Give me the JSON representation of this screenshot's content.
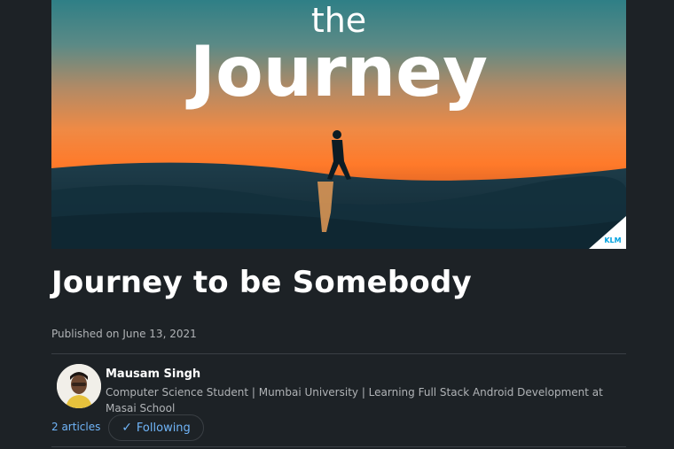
{
  "hero": {
    "overlay_small": "the",
    "overlay_large": "Journey",
    "brand_badge": "KLM"
  },
  "article": {
    "title": "Journey to be Somebody",
    "published": "Published on June 13, 2021"
  },
  "author": {
    "name": "Mausam Singh",
    "headline": "Computer Science Student | Mumbai University | Learning Full Stack Android Development at Masai School",
    "articles_link": "2 articles",
    "follow_label": "Following",
    "follow_icon": "check-icon"
  },
  "colors": {
    "background": "#1d2226",
    "link": "#70b5f9",
    "muted_text": "#b0b3b6"
  }
}
